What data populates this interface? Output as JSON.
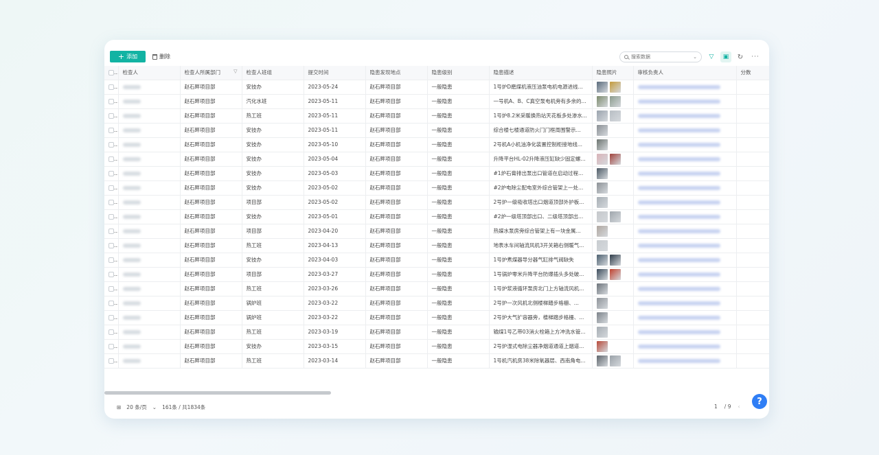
{
  "toolbar": {
    "add_label": "添加",
    "delete_label": "删除",
    "search_placeholder": "搜索数据"
  },
  "columns": [
    "检查人",
    "检查人所属部门",
    "检查人班组",
    "提交时间",
    "隐患发现地点",
    "隐患级别",
    "隐患描述",
    "隐患照片",
    "审核负责人",
    "分数"
  ],
  "colors": {
    "accent": "#12b3a3",
    "help": "#2f7ef5"
  },
  "rows": [
    {
      "dept": "赵石畔项目部",
      "team": "安技办",
      "time": "2023-05-24",
      "place": "赵石畔项目部",
      "level": "一般隐患",
      "desc": "1号炉D磨煤机液压油泵电机电源进线...",
      "photos": 2
    },
    {
      "dept": "赵石畔项目部",
      "team": "汽化水班",
      "time": "2023-05-11",
      "place": "赵石畔项目部",
      "level": "一般隐患",
      "desc": "一号机A、B、C真空泵电机旁有多余的...",
      "photos": 2
    },
    {
      "dept": "赵石畔项目部",
      "team": "热工班",
      "time": "2023-05-11",
      "place": "赵石畔项目部",
      "level": "一般隐患",
      "desc": "1号炉8.2米采暖换热站天花板多处渗水...",
      "photos": 2
    },
    {
      "dept": "赵石畔项目部",
      "team": "安技办",
      "time": "2023-05-11",
      "place": "赵石畔项目部",
      "level": "一般隐患",
      "desc": "综合楼七楼通道防火门门框周围警示...",
      "photos": 1
    },
    {
      "dept": "赵石畔项目部",
      "team": "安技办",
      "time": "2023-05-10",
      "place": "赵石畔项目部",
      "level": "一般隐患",
      "desc": "2号机A小机油净化装置控制柜接地线...",
      "photos": 1
    },
    {
      "dept": "赵石畔项目部",
      "team": "安技办",
      "time": "2023-05-04",
      "place": "赵石畔项目部",
      "level": "一般隐患",
      "desc": "升降平台HL-02升降液压缸缺少固定螺...",
      "photos": 2
    },
    {
      "dept": "赵石畔项目部",
      "team": "安技办",
      "time": "2023-05-03",
      "place": "赵石畔项目部",
      "level": "一般隐患",
      "desc": "#1炉石膏排出泵出口管道在启动过程...",
      "photos": 1
    },
    {
      "dept": "赵石畔项目部",
      "team": "安技办",
      "time": "2023-05-02",
      "place": "赵石畔项目部",
      "level": "一般隐患",
      "desc": "#2炉电除尘配电室外综合管架上一处...",
      "photos": 1
    },
    {
      "dept": "赵石畔项目部",
      "team": "项目部",
      "time": "2023-05-02",
      "place": "赵石畔项目部",
      "level": "一般隐患",
      "desc": "2号炉一级吸收塔出口烟道顶部外护板...",
      "photos": 1
    },
    {
      "dept": "赵石畔项目部",
      "team": "安技办",
      "time": "2023-05-01",
      "place": "赵石畔项目部",
      "level": "一般隐患",
      "desc": "#2炉一级塔顶部出口、二级塔顶部出...",
      "photos": 2
    },
    {
      "dept": "赵石畔项目部",
      "team": "项目部",
      "time": "2023-04-20",
      "place": "赵石畔项目部",
      "level": "一般隐患",
      "desc": "热媒水泵房旁综合管架上有一块金属...",
      "photos": 1
    },
    {
      "dept": "赵石畔项目部",
      "team": "热工班",
      "time": "2023-04-13",
      "place": "赵石畔项目部",
      "level": "一般隐患",
      "desc": "地表水车间轴流风机3开关箱右侧暖气...",
      "photos": 1
    },
    {
      "dept": "赵石畔项目部",
      "team": "安技办",
      "time": "2023-04-03",
      "place": "赵石畔项目部",
      "level": "一般隐患",
      "desc": "1号炉煮煤器导分器气缸排气阀缺失",
      "photos": 2
    },
    {
      "dept": "赵石畔项目部",
      "team": "项目部",
      "time": "2023-03-27",
      "place": "赵石畔项目部",
      "level": "一般隐患",
      "desc": "1号锅炉零米升降平台防爆插头多处破...",
      "photos": 2
    },
    {
      "dept": "赵石畔项目部",
      "team": "热工班",
      "time": "2023-03-26",
      "place": "赵石畔项目部",
      "level": "一般隐患",
      "desc": "1号炉浆液循环泵房北门上方轴流风机...",
      "photos": 1
    },
    {
      "dept": "赵石畔项目部",
      "team": "锅炉班",
      "time": "2023-03-22",
      "place": "赵石畔项目部",
      "level": "一般隐患",
      "desc": "2号炉一次风机北侧楼梯踏步格栅、...",
      "photos": 1
    },
    {
      "dept": "赵石畔项目部",
      "team": "锅炉班",
      "time": "2023-03-22",
      "place": "赵石畔项目部",
      "level": "一般隐患",
      "desc": "2号炉大气扩容器旁，楼梯踏步格栅、...",
      "photos": 1
    },
    {
      "dept": "赵石畔项目部",
      "team": "热工班",
      "time": "2023-03-19",
      "place": "赵石畔项目部",
      "level": "一般隐患",
      "desc": "输煤1号乙带03消火栓箱上方冲洗水管...",
      "photos": 1
    },
    {
      "dept": "赵石畔项目部",
      "team": "安技办",
      "time": "2023-03-15",
      "place": "赵石畔项目部",
      "level": "一般隐患",
      "desc": "2号炉湿式电除尘器净烟道通道上烟道...",
      "photos": 1
    },
    {
      "dept": "赵石畔项目部",
      "team": "热工班",
      "time": "2023-03-14",
      "place": "赵石畔项目部",
      "level": "一般隐患",
      "desc": "1号机汽机房38米除氧器层、西南角电...",
      "photos": 2
    }
  ],
  "footer": {
    "page_size": "20 条/页",
    "count": "161条 / 共1834条",
    "page_current": "1",
    "page_total": "/ 9"
  },
  "icons": [
    "plus-icon",
    "trash-icon",
    "search-icon",
    "filter-icon",
    "export-icon",
    "refresh-icon",
    "more-icon",
    "help-icon"
  ]
}
